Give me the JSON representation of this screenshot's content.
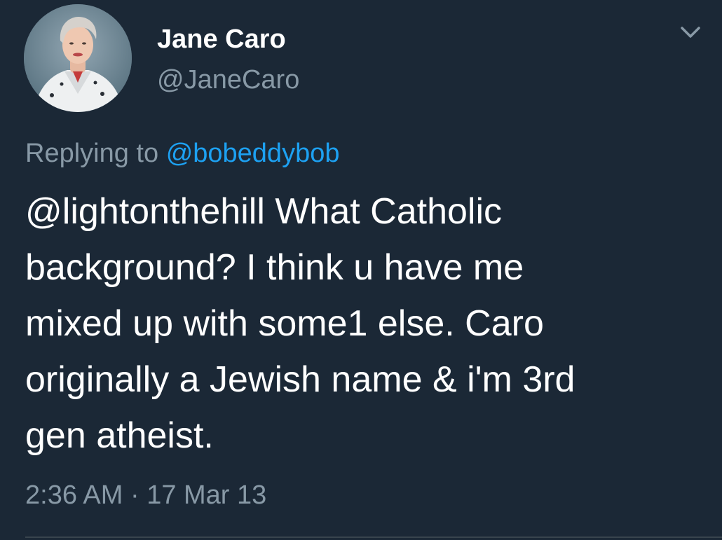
{
  "tweet": {
    "author": {
      "display_name": "Jane Caro",
      "handle": "@JaneCaro",
      "avatar_icon": "profile-photo"
    },
    "menu_icon": "chevron-down-icon",
    "reply": {
      "prefix": "Replying to",
      "to_handle": "@bobeddybob"
    },
    "text_lines": [
      "@lightonthehill What Catholic",
      "background? I think u have me",
      "mixed up with some1 else. Caro",
      "originally a Jewish name & i'm 3rd",
      "gen atheist."
    ],
    "timestamp": "2:36 AM · 17 Mar 13"
  },
  "colors": {
    "background": "#1b2836",
    "primary_text": "#ffffff",
    "secondary_text": "#8899a6",
    "link": "#1da1f2",
    "divider": "#38444d"
  }
}
